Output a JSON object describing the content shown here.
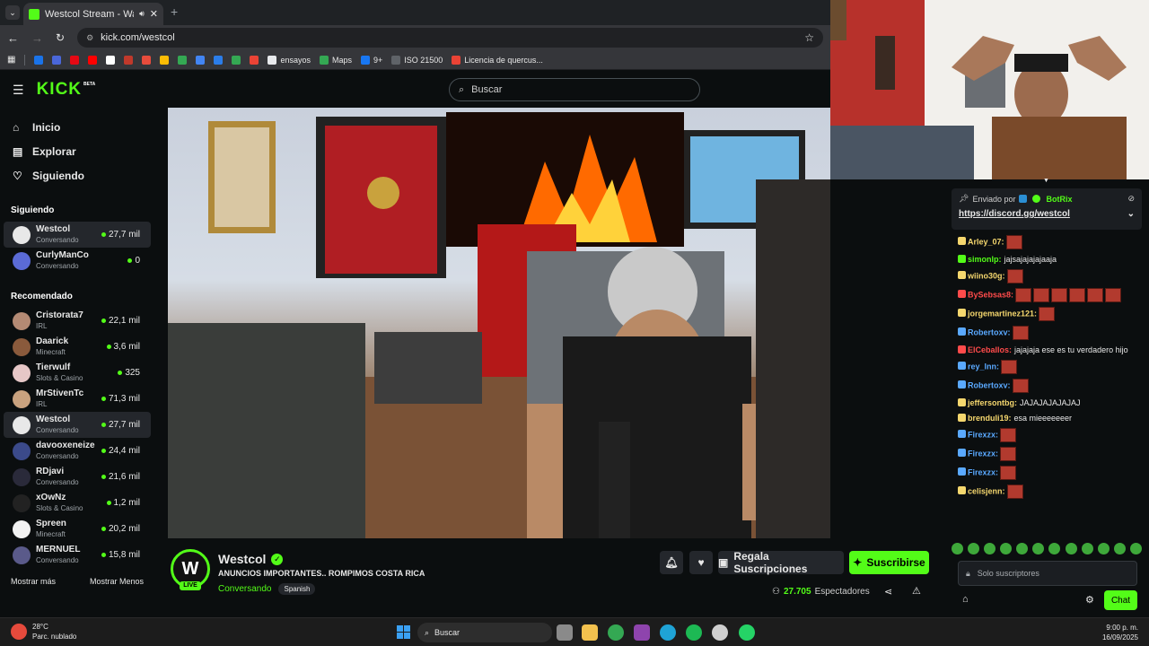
{
  "browser": {
    "tab_title": "Westcol Stream - Watch Li",
    "url": "kick.com/westcol",
    "bookmarks": [
      {
        "label": "",
        "color": "#1a73e8"
      },
      {
        "label": "",
        "color": "#4a67d9"
      },
      {
        "label": "",
        "color": "#e50914"
      },
      {
        "label": "",
        "color": "#ff0000"
      },
      {
        "label": "",
        "color": "#ffffff"
      },
      {
        "label": "",
        "color": "#c0392b"
      },
      {
        "label": "",
        "color": "#e74c3c"
      },
      {
        "label": "",
        "color": "#fbbc05"
      },
      {
        "label": "",
        "color": "#34a853"
      },
      {
        "label": "",
        "color": "#4285f4"
      },
      {
        "label": "",
        "color": "#2b7de9"
      },
      {
        "label": "",
        "color": "#34a853"
      },
      {
        "label": "",
        "color": "#ea4335"
      },
      {
        "label": "ensayos",
        "color": "#e8eaed"
      },
      {
        "label": "Maps",
        "color": "#34a853"
      },
      {
        "label": "9+",
        "color": "#1877f2"
      },
      {
        "label": "ISO 21500",
        "color": "#5f6368"
      },
      {
        "label": "Licencia de quercus...",
        "color": "#ea4335"
      }
    ]
  },
  "header": {
    "logo": "KICK",
    "logo_beta": "BETA",
    "search_placeholder": "Buscar"
  },
  "sidebar": {
    "nav": [
      {
        "label": "Inicio",
        "icon": "home-icon"
      },
      {
        "label": "Explorar",
        "icon": "explore-icon"
      },
      {
        "label": "Siguiendo",
        "icon": "heart-icon"
      }
    ],
    "following_title": "Siguiendo",
    "following": [
      {
        "name": "Westcol",
        "category": "Conversando",
        "viewers": "27,7 mil",
        "avatar_color": "#e8e8e8",
        "selected": true
      },
      {
        "name": "CurlyManCo",
        "category": "Conversando",
        "viewers": "0",
        "avatar_color": "#5b6bd6",
        "selected": false
      }
    ],
    "recommended_title": "Recomendado",
    "recommended": [
      {
        "name": "Cristorata7",
        "category": "IRL",
        "viewers": "22,1 mil",
        "avatar_color": "#b48a74"
      },
      {
        "name": "Daarick",
        "category": "Minecraft",
        "viewers": "3,6 mil",
        "avatar_color": "#8a5a3c"
      },
      {
        "name": "Tierwulf",
        "category": "Slots & Casino",
        "viewers": "325",
        "avatar_color": "#e6c7c7"
      },
      {
        "name": "MrStivenTc",
        "category": "IRL",
        "viewers": "71,3 mil",
        "avatar_color": "#c9a27f"
      },
      {
        "name": "Westcol",
        "category": "Conversando",
        "viewers": "27,7 mil",
        "avatar_color": "#e8e8e8",
        "selected": true
      },
      {
        "name": "davooxeneize",
        "category": "Conversando",
        "viewers": "24,4 mil",
        "avatar_color": "#3b4a8a"
      },
      {
        "name": "RDjavi",
        "category": "Conversando",
        "viewers": "21,6 mil",
        "avatar_color": "#2a2a3a"
      },
      {
        "name": "xOwNz",
        "category": "Slots & Casino",
        "viewers": "1,2 mil",
        "avatar_color": "#222"
      },
      {
        "name": "Spreen",
        "category": "Minecraft",
        "viewers": "20,2 mil",
        "avatar_color": "#f2f2f2"
      },
      {
        "name": "MERNUEL",
        "category": "Conversando",
        "viewers": "15,8 mil",
        "avatar_color": "#5a5a8a"
      }
    ],
    "show_more": "Mostrar más",
    "show_less": "Mostrar Menos"
  },
  "stream": {
    "channel": "Westcol",
    "title": "ANUNCIOS IMPORTANTES.. ROMPIMOS COSTA RICA",
    "category": "Conversando",
    "language": "Spanish",
    "live": "LIVE",
    "avatar_letter": "W",
    "gift_label": "Regala Suscripciones",
    "subscribe_label": "Suscribirse",
    "viewers": "27.705",
    "viewers_label": "Espectadores"
  },
  "chat": {
    "pinned_by_label": "Enviado por",
    "pinned_by": "BotRix",
    "pinned_link": "https://discord.gg/westcol",
    "messages": [
      {
        "user": "Arley_07:",
        "color": "#f5d76e",
        "text": "",
        "emotes": 1
      },
      {
        "user": "simonlp:",
        "color": "#53fc18",
        "text": "jajsajajajajaaja",
        "emotes": 0
      },
      {
        "user": "wiino30g:",
        "color": "#f5d76e",
        "text": "",
        "emotes": 1
      },
      {
        "user": "BySebsas8:",
        "color": "#ff4b4b",
        "text": "",
        "emotes": 6
      },
      {
        "user": "jorgemartinez121:",
        "color": "#f5d76e",
        "text": "",
        "emotes": 1
      },
      {
        "user": "Robertoxv:",
        "color": "#5aa9ff",
        "text": "",
        "emotes": 1
      },
      {
        "user": "ElCeballos:",
        "color": "#ff4b4b",
        "text": "jajajaja ese es tu verdadero hijo",
        "emotes": 0
      },
      {
        "user": "rey_lnn:",
        "color": "#5aa9ff",
        "text": "",
        "emotes": 1
      },
      {
        "user": "Robertoxv:",
        "color": "#5aa9ff",
        "text": "",
        "emotes": 1
      },
      {
        "user": "jeffersontbg:",
        "color": "#f5d76e",
        "text": "JAJAJAJAJAJAJ",
        "emotes": 0
      },
      {
        "user": "brenduli19:",
        "color": "#f5d76e",
        "text": "esa mieeeeeeer",
        "emotes": 0
      },
      {
        "user": "Firexzx:",
        "color": "#5aa9ff",
        "text": "",
        "emotes": 1
      },
      {
        "user": "Firexzx:",
        "color": "#5aa9ff",
        "text": "",
        "emotes": 1
      },
      {
        "user": "Firexzx:",
        "color": "#5aa9ff",
        "text": "",
        "emotes": 1
      },
      {
        "user": "celisjenn:",
        "color": "#f5d76e",
        "text": "",
        "emotes": 1
      }
    ],
    "input_placeholder": "Solo suscriptores",
    "send_label": "Chat"
  },
  "taskbar": {
    "weather_temp": "28°C",
    "weather_desc": "Parc. nublado",
    "search_label": "Buscar",
    "time": "9:00 p. m.",
    "date": "16/09/2025"
  },
  "colors": {
    "accent": "#53fc18",
    "bg": "#0b0e0f"
  }
}
